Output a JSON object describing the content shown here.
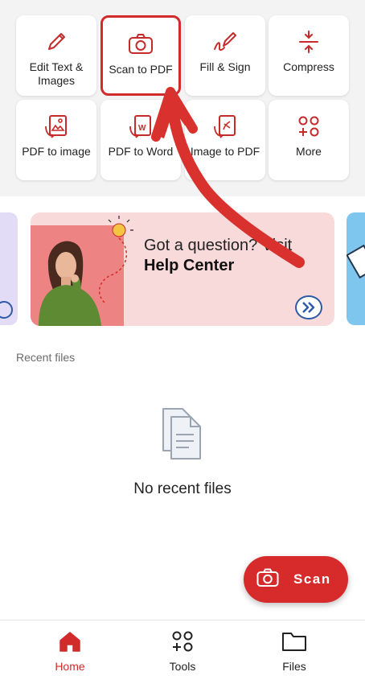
{
  "tools": [
    {
      "label": "Edit Text & Images",
      "icon": "pencil-icon"
    },
    {
      "label": "Scan to PDF",
      "icon": "camera-icon",
      "highlighted": true
    },
    {
      "label": "Fill & Sign",
      "icon": "pen-signature-icon"
    },
    {
      "label": "Compress",
      "icon": "compress-icon"
    },
    {
      "label": "PDF to image",
      "icon": "pdf-image-icon"
    },
    {
      "label": "PDF to Word",
      "icon": "pdf-word-icon"
    },
    {
      "label": "Image to PDF",
      "icon": "image-pdf-icon"
    },
    {
      "label": "More",
      "icon": "more-grid-icon"
    }
  ],
  "help_banner": {
    "line1": "Got a question? Visit",
    "line2": "Help Center"
  },
  "recent": {
    "title": "Recent files",
    "empty_text": "No recent files"
  },
  "scan_button": {
    "label": "Scan",
    "icon": "camera-icon"
  },
  "bottom_nav": [
    {
      "label": "Home",
      "icon": "home-icon",
      "active": true
    },
    {
      "label": "Tools",
      "icon": "tools-icon"
    },
    {
      "label": "Files",
      "icon": "folder-icon"
    }
  ],
  "colors": {
    "accent": "#d12b2b",
    "link_blue": "#2f5aa7",
    "banner_bg": "#f8dada"
  }
}
